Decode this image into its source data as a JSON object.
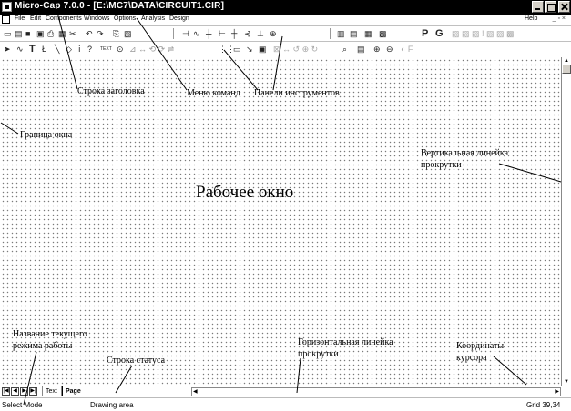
{
  "titlebar": {
    "title": "Micro-Cap 7.0.0 - [E:\\MC7\\DATA\\CIRCUIT1.CIR]"
  },
  "menu": {
    "items": [
      "File",
      "Edit",
      "Components",
      "Windows",
      "Options",
      "Analysis",
      "Design"
    ],
    "help": "Help"
  },
  "toolbar_row2": {
    "text_button": "TEXT",
    "letters": [
      "P",
      "G"
    ]
  },
  "tabs": {
    "text": "Text",
    "page": "Page 1"
  },
  "status": {
    "mode": "Select Mode",
    "area": "Drawing area",
    "grid": "Grid 39,34"
  },
  "annotations": {
    "title_bar": "Строка заголовка",
    "menu": "Меню команд",
    "toolbars": "Панели инструментов",
    "window_border": "Граница окна",
    "vscroll_line1": "Вертикальная линейка",
    "vscroll_line2": "прокрутки",
    "work_window": "Рабочее окно",
    "mode_line1": "Название текущего",
    "mode_line2": "режима работы",
    "status_line": "Строка статуса",
    "hscroll_line1": "Горизонтальная линейка",
    "hscroll_line2": "прокрутки",
    "cursor_line1": "Координаты",
    "cursor_line2": "курсора"
  },
  "icons": [
    "app-icon",
    "new-icon",
    "open-icon",
    "save-icon",
    "print-icon",
    "cut-icon",
    "copy-icon",
    "paste-icon",
    "pointer-icon",
    "wire-icon",
    "text-tool-icon",
    "find-icon",
    "zoom-in-icon",
    "zoom-out-icon"
  ],
  "colors": {
    "titlebar_bg": "#000000",
    "title_text": "#ffffff",
    "grid_dot": "#7a7a7a"
  }
}
